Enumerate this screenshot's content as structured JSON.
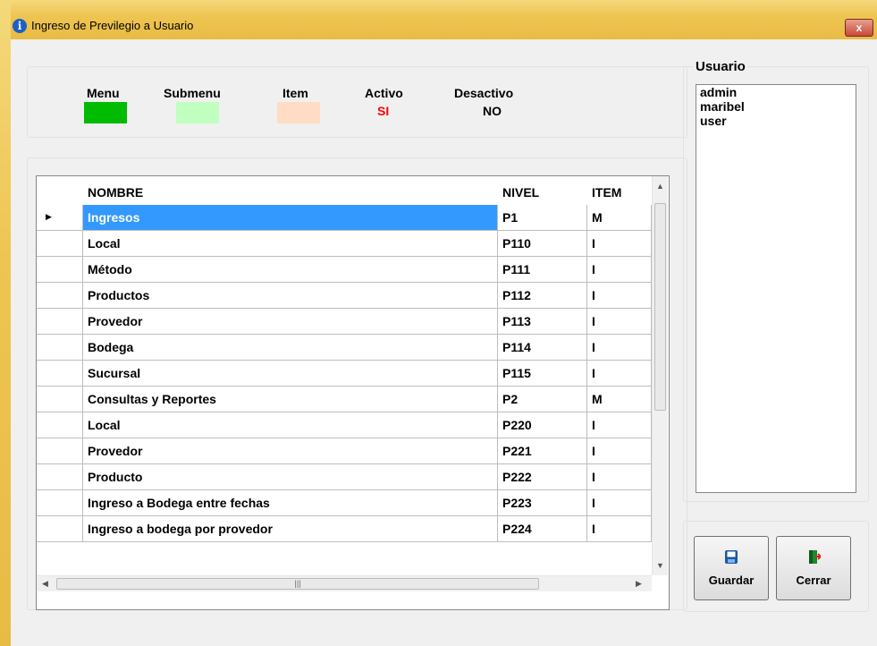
{
  "window": {
    "title": "Ingreso de Previlegio a Usuario",
    "close_label": "x"
  },
  "legend": {
    "menu_label": "Menu",
    "submenu_label": "Submenu",
    "item_label": "Item",
    "activo_label": "Activo",
    "activo_value": "SI",
    "desactivo_label": "Desactivo",
    "desactivo_value": "NO",
    "colors": {
      "menu": "#00bb00",
      "submenu": "#c0ffc0",
      "item": "#ffdcc3",
      "activo_value": "#ff0000"
    }
  },
  "grid": {
    "columns": [
      "NOMBRE",
      "NIVEL",
      "ITEM"
    ],
    "rows": [
      {
        "nombre": "Ingresos",
        "nivel": "P1",
        "item": "M",
        "selected": true
      },
      {
        "nombre": "Local",
        "nivel": "P110",
        "item": "I"
      },
      {
        "nombre": "Método",
        "nivel": "P111",
        "item": "I"
      },
      {
        "nombre": "Productos",
        "nivel": "P112",
        "item": "I"
      },
      {
        "nombre": "Provedor",
        "nivel": "P113",
        "item": "I"
      },
      {
        "nombre": "Bodega",
        "nivel": "P114",
        "item": "I"
      },
      {
        "nombre": "Sucursal",
        "nivel": "P115",
        "item": "I"
      },
      {
        "nombre": "Consultas y Reportes",
        "nivel": "P2",
        "item": "M"
      },
      {
        "nombre": "Local",
        "nivel": "P220",
        "item": "I"
      },
      {
        "nombre": "Provedor",
        "nivel": "P221",
        "item": "I"
      },
      {
        "nombre": "Producto",
        "nivel": "P222",
        "item": "I"
      },
      {
        "nombre": "Ingreso a Bodega entre fechas",
        "nivel": "P223",
        "item": "I"
      },
      {
        "nombre": "Ingreso a bodega por provedor",
        "nivel": "P224",
        "item": "I"
      }
    ],
    "selection_color": "#3399ff"
  },
  "users": {
    "label": "Usuario",
    "items": [
      "admin",
      "maribel",
      "user"
    ]
  },
  "buttons": {
    "save_label": "Guardar",
    "close_label": "Cerrar"
  }
}
